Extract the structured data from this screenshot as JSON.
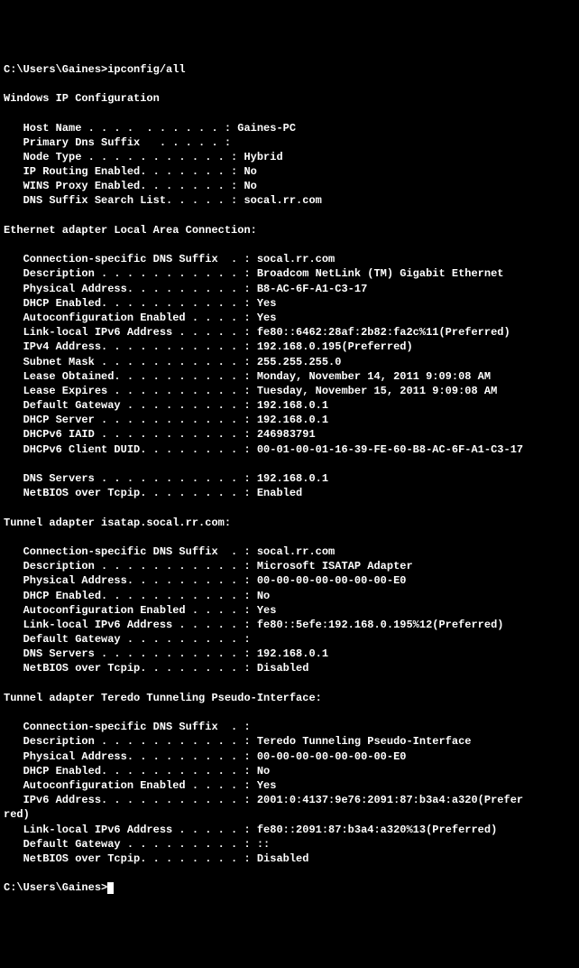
{
  "prompt1": "C:\\Users\\Gaines>ipconfig/all",
  "blank": "",
  "header": "Windows IP Configuration",
  "host_name": "   Host Name . . . .  . . . . . . : Gaines-PC",
  "primary_dns_suffix": "   Primary Dns Suffix   . . . . . :",
  "node_type": "   Node Type . . . . . . . . . . . : Hybrid",
  "ip_routing": "   IP Routing Enabled. . . . . . . : No",
  "wins_proxy": "   WINS Proxy Enabled. . . . . . . : No",
  "dns_suffix_search": "   DNS Suffix Search List. . . . . : socal.rr.com",
  "eth_header": "Ethernet adapter Local Area Connection:",
  "eth_conn_suffix": "   Connection-specific DNS Suffix  . : socal.rr.com",
  "eth_desc": "   Description . . . . . . . . . . . : Broadcom NetLink (TM) Gigabit Ethernet",
  "eth_phys": "   Physical Address. . . . . . . . . : B8-AC-6F-A1-C3-17",
  "eth_dhcp": "   DHCP Enabled. . . . . . . . . . . : Yes",
  "eth_autoconf": "   Autoconfiguration Enabled . . . . : Yes",
  "eth_ll_ipv6": "   Link-local IPv6 Address . . . . . : fe80::6462:28af:2b82:fa2c%11(Preferred)",
  "eth_ipv4": "   IPv4 Address. . . . . . . . . . . : 192.168.0.195(Preferred)",
  "eth_subnet": "   Subnet Mask . . . . . . . . . . . : 255.255.255.0",
  "eth_lease_obt": "   Lease Obtained. . . . . . . . . . : Monday, November 14, 2011 9:09:08 AM",
  "eth_lease_exp": "   Lease Expires . . . . . . . . . . : Tuesday, November 15, 2011 9:09:08 AM",
  "eth_gateway": "   Default Gateway . . . . . . . . . : 192.168.0.1",
  "eth_dhcp_srv": "   DHCP Server . . . . . . . . . . . : 192.168.0.1",
  "eth_dhcpv6_iaid": "   DHCPv6 IAID . . . . . . . . . . . : 246983791",
  "eth_dhcpv6_duid": "   DHCPv6 Client DUID. . . . . . . . : 00-01-00-01-16-39-FE-60-B8-AC-6F-A1-C3-17",
  "eth_dns": "   DNS Servers . . . . . . . . . . . : 192.168.0.1",
  "eth_netbios": "   NetBIOS over Tcpip. . . . . . . . : Enabled",
  "isatap_header": "Tunnel adapter isatap.socal.rr.com:",
  "isatap_conn_suffix": "   Connection-specific DNS Suffix  . : socal.rr.com",
  "isatap_desc": "   Description . . . . . . . . . . . : Microsoft ISATAP Adapter",
  "isatap_phys": "   Physical Address. . . . . . . . . : 00-00-00-00-00-00-00-E0",
  "isatap_dhcp": "   DHCP Enabled. . . . . . . . . . . : No",
  "isatap_autoconf": "   Autoconfiguration Enabled . . . . : Yes",
  "isatap_ll_ipv6": "   Link-local IPv6 Address . . . . . : fe80::5efe:192.168.0.195%12(Preferred)",
  "isatap_gateway": "   Default Gateway . . . . . . . . . :",
  "isatap_dns": "   DNS Servers . . . . . . . . . . . : 192.168.0.1",
  "isatap_netbios": "   NetBIOS over Tcpip. . . . . . . . : Disabled",
  "teredo_header": "Tunnel adapter Teredo Tunneling Pseudo-Interface:",
  "teredo_conn_suffix": "   Connection-specific DNS Suffix  . :",
  "teredo_desc": "   Description . . . . . . . . . . . : Teredo Tunneling Pseudo-Interface",
  "teredo_phys": "   Physical Address. . . . . . . . . : 00-00-00-00-00-00-00-E0",
  "teredo_dhcp": "   DHCP Enabled. . . . . . . . . . . : No",
  "teredo_autoconf": "   Autoconfiguration Enabled . . . . : Yes",
  "teredo_ipv6": "   IPv6 Address. . . . . . . . . . . : 2001:0:4137:9e76:2091:87:b3a4:a320(Prefer",
  "teredo_ipv6_wrap": "red)",
  "teredo_ll_ipv6": "   Link-local IPv6 Address . . . . . : fe80::2091:87:b3a4:a320%13(Preferred)",
  "teredo_gateway": "   Default Gateway . . . . . . . . . : ::",
  "teredo_netbios": "   NetBIOS over Tcpip. . . . . . . . : Disabled",
  "prompt2": "C:\\Users\\Gaines>"
}
